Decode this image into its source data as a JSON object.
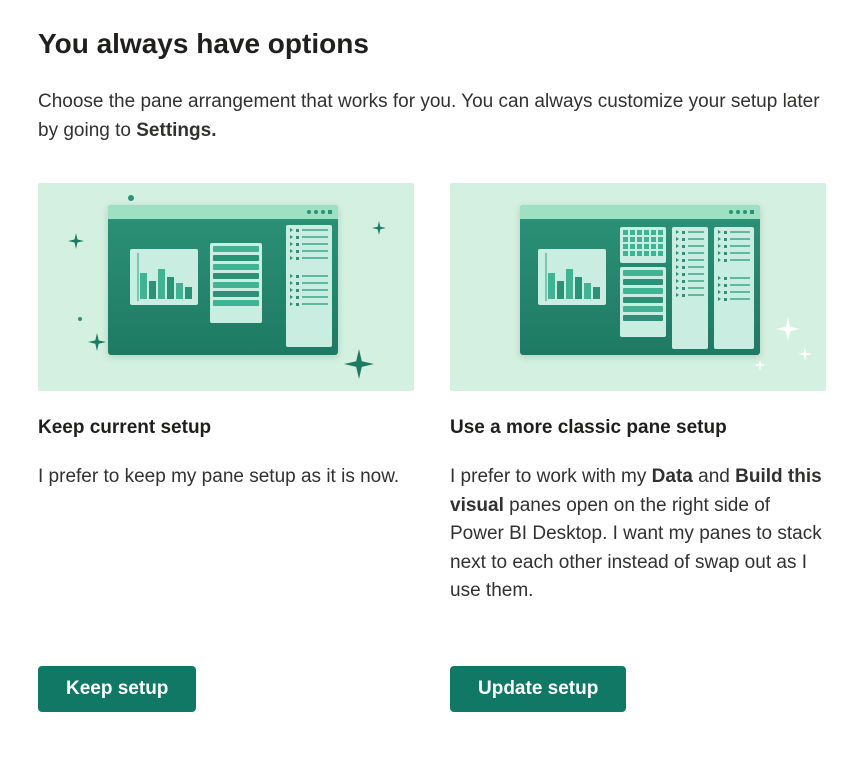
{
  "title": "You always have options",
  "subtitle_pre": "Choose the pane arrangement that works for you. You can always customize your setup later by going to ",
  "subtitle_bold": "Settings.",
  "options": {
    "keep": {
      "heading": "Keep current setup",
      "desc": "I prefer to keep my pane setup as it is now.",
      "button": "Keep setup"
    },
    "classic": {
      "heading": "Use a more classic pane setup",
      "desc_pre": "I prefer to work with my ",
      "desc_bold1": "Data",
      "desc_mid": " and ",
      "desc_bold2": "Build this visual",
      "desc_post": " panes open on the right side of Power BI Desktop. I want my panes to stack next to each other instead of swap out as I use them.",
      "button": "Update setup"
    }
  },
  "colors": {
    "primary": "#117865",
    "illustration_bg": "#d4f0e1"
  }
}
